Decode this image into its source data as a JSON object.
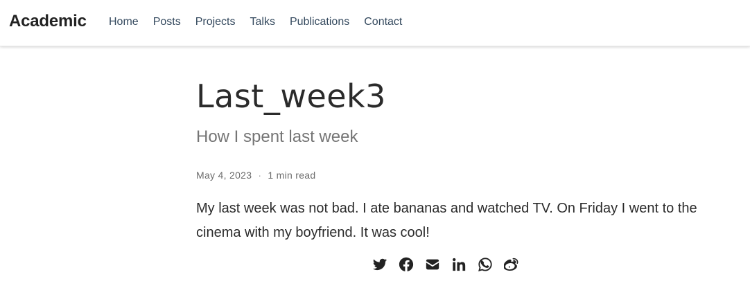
{
  "navbar": {
    "brand": "Academic",
    "links": [
      {
        "label": "Home"
      },
      {
        "label": "Posts"
      },
      {
        "label": "Projects"
      },
      {
        "label": "Talks"
      },
      {
        "label": "Publications"
      },
      {
        "label": "Contact"
      }
    ]
  },
  "article": {
    "title": "Last_week3",
    "subtitle": "How I spent last week",
    "date": "May 4, 2023",
    "separator": "·",
    "read_time": "1 min read",
    "body": "My last week was not bad. I ate bananas and watched TV. On Friday I went to the cinema with my boyfriend. It was cool!"
  },
  "share": {
    "icons": [
      "twitter-icon",
      "facebook-icon",
      "email-icon",
      "linkedin-icon",
      "whatsapp-icon",
      "weibo-icon"
    ],
    "icon_color": "#222222"
  },
  "colors": {
    "nav_link": "#34495e",
    "text": "#2b2b2b",
    "subtitle": "#757575",
    "meta": "#6c6c6c"
  }
}
